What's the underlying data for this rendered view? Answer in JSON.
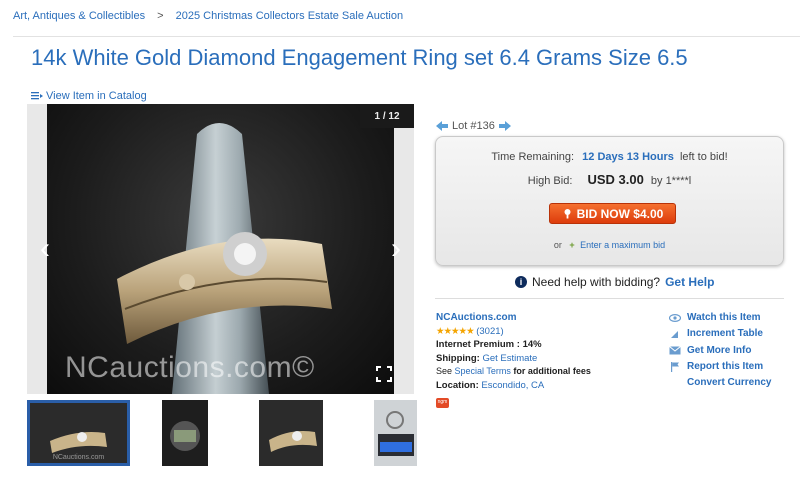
{
  "breadcrumb": {
    "items": [
      "Art, Antiques & Collectibles",
      "2025 Christmas Collectors Estate Sale Auction"
    ],
    "separator": ">"
  },
  "title": "14k White Gold Diamond Engagement Ring set 6.4 Grams Size 6.5",
  "catalog_link": "View Item in Catalog",
  "gallery": {
    "counter": "1 / 12",
    "watermark": "NCauctions.com©",
    "thumb_watermark": "NCauctions.com"
  },
  "lot": {
    "label": "Lot #136"
  },
  "bidding": {
    "time_label": "Time Remaining:",
    "time_value": "12 Days 13 Hours",
    "time_suffix": "left to bid!",
    "high_label": "High Bid:",
    "high_amount": "USD 3.00",
    "high_by": "by 1****l",
    "bid_button": "BID NOW $4.00",
    "or_text": "or",
    "max_bid_link": "Enter a maximum bid"
  },
  "help": {
    "text": "Need help with bidding?",
    "link": "Get Help"
  },
  "seller": {
    "name": "NCAuctions.com",
    "stars": "★★★★★",
    "reviews": "(3021)",
    "premium": "Internet Premium : 14%",
    "shipping_label": "Shipping:",
    "shipping_link": "Get Estimate",
    "terms_pre": "See",
    "terms_link": "Special Terms",
    "terms_post": "for additional fees",
    "location_label": "Location:",
    "location_value": "Escondido, CA",
    "badge": "ngm"
  },
  "actions": [
    {
      "label": "Watch this Item",
      "icon": "eye-icon"
    },
    {
      "label": "Increment Table",
      "icon": "triangle-icon"
    },
    {
      "label": "Get More Info",
      "icon": "mail-icon"
    },
    {
      "label": "Report this Item",
      "icon": "flag-icon"
    },
    {
      "label": "Convert Currency",
      "icon": ""
    }
  ],
  "colors": {
    "link": "#2a6ebb",
    "bid_button": "#e84a12",
    "stars": "#f4a400",
    "thumb_active_border": "#2a5ea8"
  }
}
